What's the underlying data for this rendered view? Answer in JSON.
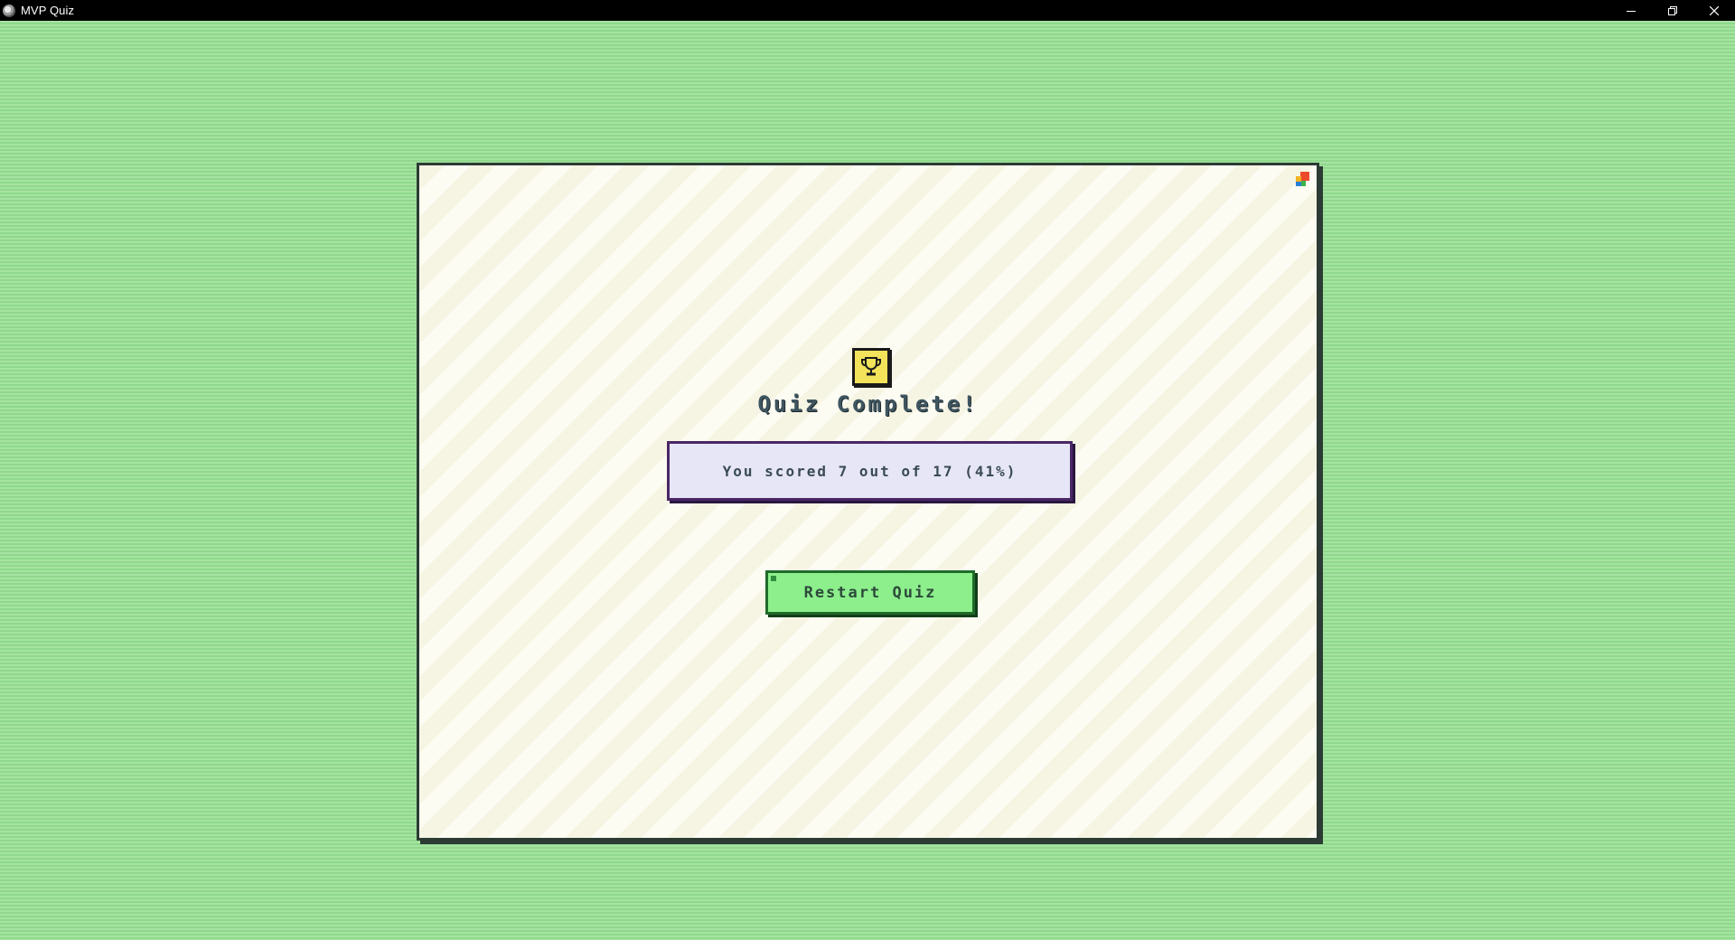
{
  "window": {
    "title": "MVP Quiz",
    "app_icon": "gear-icon",
    "controls": [
      "minimize-icon",
      "restore-icon",
      "close-icon"
    ]
  },
  "result": {
    "icon": "trophy-icon",
    "heading": "Quiz Complete!",
    "score_text": "You scored 7 out of 17 (41%)"
  },
  "actions": {
    "restart_label": "Restart Quiz"
  },
  "colors": {
    "desktop_green": "#a6e3a2",
    "card_bg": "#fdfcf3",
    "score_border": "#4a2766",
    "button_green": "#8cef8c",
    "trophy_yellow": "#f3e35a"
  }
}
